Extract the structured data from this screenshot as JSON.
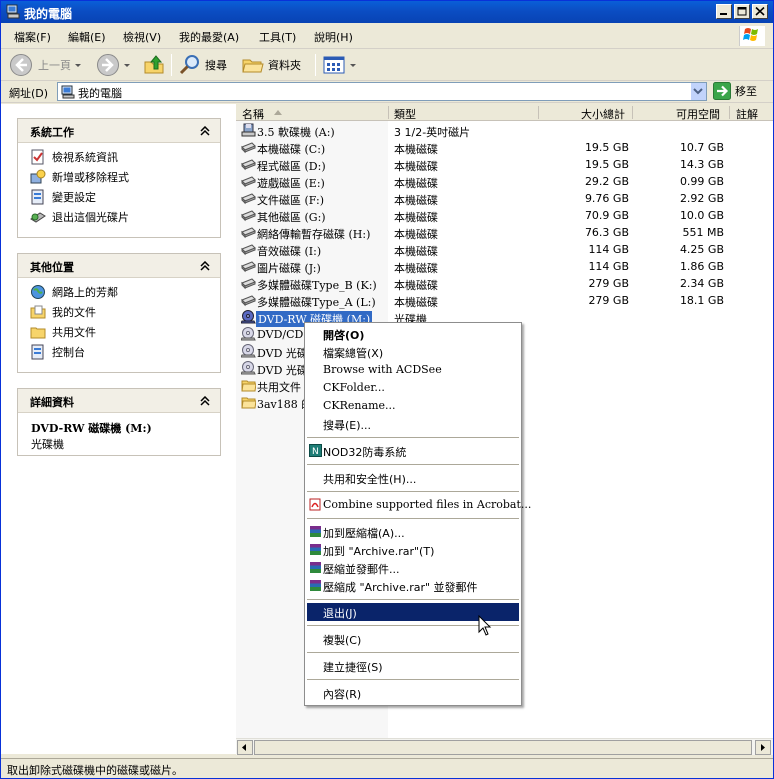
{
  "window": {
    "title": "我的電腦"
  },
  "menubar": {
    "items": [
      "檔案(F)",
      "編輯(E)",
      "檢視(V)",
      "我的最愛(A)",
      "工具(T)",
      "說明(H)"
    ]
  },
  "toolbar": {
    "back_label": "上一頁",
    "search_label": "搜尋",
    "folders_label": "資料夾"
  },
  "address": {
    "label": "網址(D)",
    "value": "我的電腦",
    "go_label": "移至"
  },
  "tasks_panel": {
    "title": "系統工作",
    "items": [
      "檢視系統資訊",
      "新增或移除程式",
      "變更設定",
      "退出這個光碟片"
    ]
  },
  "places_panel": {
    "title": "其他位置",
    "items": [
      "網路上的芳鄰",
      "我的文件",
      "共用文件",
      "控制台"
    ]
  },
  "details_panel": {
    "title": "詳細資料",
    "name": "DVD-RW 磁碟機 (M:)",
    "type": "光碟機"
  },
  "columns": {
    "name": "名稱",
    "type": "類型",
    "size": "大小總計",
    "free": "可用空間",
    "comment": "註解"
  },
  "rows": [
    {
      "name": "3.5 軟碟機 (A:)",
      "type": "3 1/2-英吋磁片",
      "size": "",
      "free": ""
    },
    {
      "name": "本機磁碟 (C:)",
      "type": "本機磁碟",
      "size": "19.5 GB",
      "free": "10.7 GB"
    },
    {
      "name": "程式磁區 (D:)",
      "type": "本機磁碟",
      "size": "19.5 GB",
      "free": "14.3 GB"
    },
    {
      "name": "遊戲磁區 (E:)",
      "type": "本機磁碟",
      "size": "29.2 GB",
      "free": "0.99 GB"
    },
    {
      "name": "文件磁區 (F:)",
      "type": "本機磁碟",
      "size": "9.76 GB",
      "free": "2.92 GB"
    },
    {
      "name": "其他磁區 (G:)",
      "type": "本機磁碟",
      "size": "70.9 GB",
      "free": "10.0 GB"
    },
    {
      "name": "網絡傳輸暫存磁碟 (H:)",
      "type": "本機磁碟",
      "size": "76.3 GB",
      "free": "551 MB"
    },
    {
      "name": "音效磁碟 (I:)",
      "type": "本機磁碟",
      "size": "114 GB",
      "free": "4.25 GB"
    },
    {
      "name": "圖片磁碟 (J:)",
      "type": "本機磁碟",
      "size": "114 GB",
      "free": "1.86 GB"
    },
    {
      "name": "多媒體磁碟Type_B (K:)",
      "type": "本機磁碟",
      "size": "279 GB",
      "free": "2.34 GB"
    },
    {
      "name": "多媒體磁碟Type_A (L:)",
      "type": "本機磁碟",
      "size": "279 GB",
      "free": "18.1 GB"
    },
    {
      "name": "DVD-RW 磁碟機 (M:)",
      "type": "光碟機",
      "size": "",
      "free": ""
    },
    {
      "name": "DVD/CD-",
      "type": "",
      "size": "",
      "free": ""
    },
    {
      "name": "DVD 光碟",
      "type": "",
      "size": "",
      "free": ""
    },
    {
      "name": "DVD 光碟",
      "type": "",
      "size": "",
      "free": ""
    },
    {
      "name": "共用文件",
      "type": "",
      "size": "",
      "free": ""
    },
    {
      "name": "3av188 的",
      "type": "",
      "size": "",
      "free": ""
    }
  ],
  "context_menu": {
    "open": "開啓(O)",
    "explore": "檔案總管(X)",
    "acdsee": "Browse with ACDSee",
    "ckfolder": "CKFolder...",
    "ckrename": "CKRename...",
    "search": "搜尋(E)...",
    "nod32": "NOD32防毒系統",
    "sharing": "共用和安全性(H)...",
    "acrobat": "Combine supported files in Acrobat...",
    "add_archive": "加到壓縮檔(A)...",
    "add_rar": "加到 \"Archive.rar\"(T)",
    "compress_email": "壓縮並發郵件...",
    "compress_rar_email": "壓縮成 \"Archive.rar\" 並發郵件",
    "eject": "退出(J)",
    "copy": "複製(C)",
    "shortcut": "建立捷徑(S)",
    "properties": "內容(R)"
  },
  "status": {
    "text": "取出卸除式磁碟機中的磁碟或磁片。"
  },
  "colors": {
    "titlebar": "#0b4dc3",
    "highlight": "#0a246a",
    "selection": "#316ac5"
  }
}
